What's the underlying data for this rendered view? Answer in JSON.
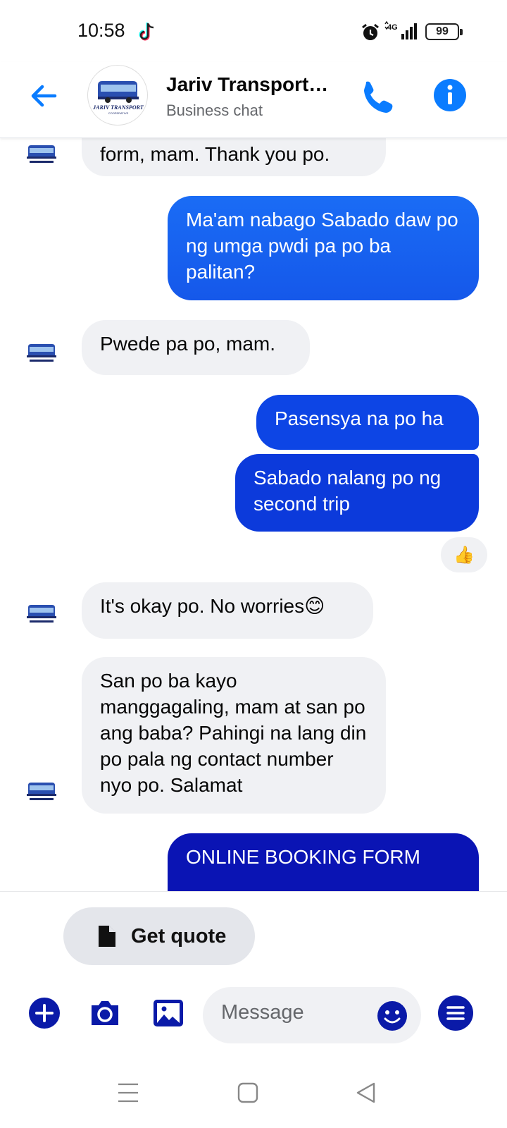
{
  "status": {
    "time": "10:58",
    "network": "4G",
    "battery": "99",
    "icons": [
      "tiktok-icon",
      "alarm-icon",
      "signal-icon",
      "battery-icon"
    ]
  },
  "header": {
    "title": "Jariv Transport…",
    "subtitle": "Business chat",
    "avatar_text": "JARIV TRANSPORT",
    "avatar_subtext": "COOPERATIVE"
  },
  "messages": [
    {
      "from": "business",
      "text": "form, mam. Thank you po."
    },
    {
      "from": "me",
      "text": "Ma'am nabago Sabado daw po ng umga pwdi pa po ba palitan?"
    },
    {
      "from": "business",
      "text": "Pwede pa po, mam."
    },
    {
      "from": "me",
      "text": "Pasensya na po ha"
    },
    {
      "from": "me",
      "text": "Sabado nalang po ng second trip",
      "reaction": "👍"
    },
    {
      "from": "business",
      "text": "It's okay po. No worries",
      "emoji": "😊"
    },
    {
      "from": "business",
      "text": "San po ba kayo manggagaling, mam at san po ang baba? Pahingi na lang din po pala ng contact number nyo po. Salamat"
    },
    {
      "from": "me",
      "text": "ONLINE BOOKING FORM"
    }
  ],
  "quick_reply": {
    "label": "Get quote"
  },
  "composer": {
    "placeholder": "Message"
  },
  "colors": {
    "messenger_blue": "#0a7cff",
    "gradient_top": "#1a6cf5",
    "gradient_mid": "#0d3fe0",
    "gradient_bottom": "#0a14b4",
    "incoming_bubble": "#f0f1f4",
    "composer_icon": "#0a1aa8"
  }
}
